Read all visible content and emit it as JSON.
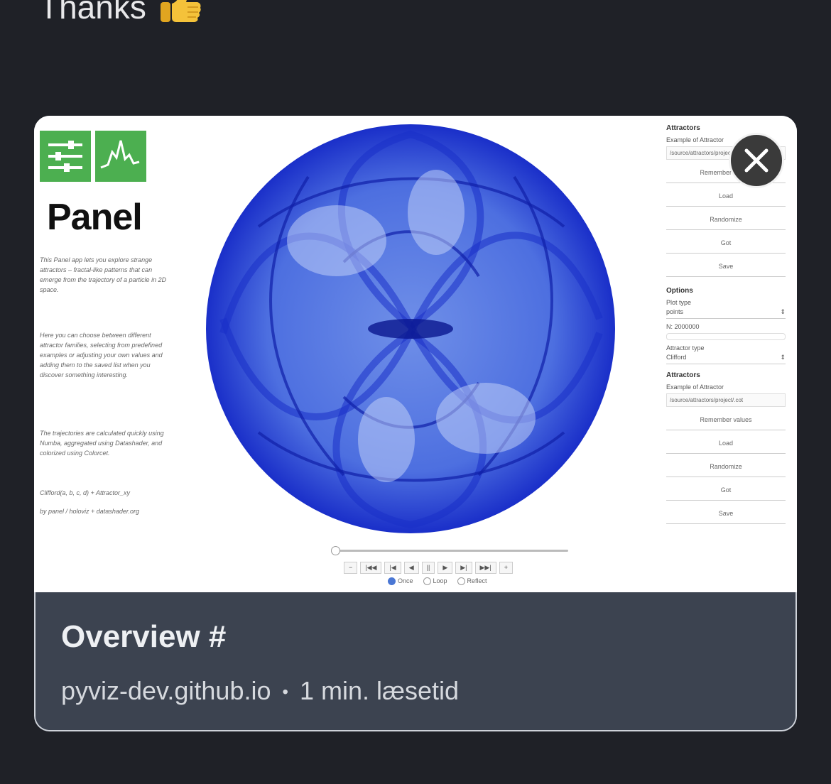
{
  "message": {
    "text": "Thanks",
    "emoji_icon": "thumbs-up-icon"
  },
  "link_card": {
    "title": "Overview #",
    "domain": "pyviz-dev.github.io",
    "separator": "•",
    "read_time": "1 min. læsetid",
    "close_icon": "close-icon",
    "preview": {
      "logo_text": "Panel",
      "description_1": "This Panel app lets you explore strange attractors – fractal-like patterns that can emerge from the trajectory of a particle in 2D space.",
      "description_2": "Here you can choose between different attractor families, selecting from predefined examples or adjusting your own values and adding them to the saved list when you discover something interesting.",
      "description_3": "The trajectories are calculated quickly using Numba, aggregated using Datashader, and colorized using Colorcet.",
      "footer_1": "Clifford(a, b, c, d) + Attractor_xy",
      "footer_2": "by panel / holoviz + datashader.org",
      "playback_labels": [
        "−",
        "|◀◀",
        "|◀",
        "◀",
        "||",
        "▶",
        "▶|",
        "▶▶|",
        "+"
      ],
      "loop_options": [
        "Once",
        "Loop",
        "Reflect"
      ],
      "selected_loop": "Once",
      "right_panel": {
        "attractors_heading": "Attractors",
        "example_label": "Example of Attractor",
        "example_value": "/source/attractors/project/.cot",
        "remember_label": "Remember values",
        "load_label": "Load",
        "random_label": "Randomize",
        "got_label": "Got",
        "save_label": "Save",
        "options_heading": "Options",
        "plot_type_label": "Plot type",
        "plot_type_value": "points",
        "n_label": "N: 2000000",
        "attractor_type_label": "Attractor type",
        "attractor_type_value": "Clifford",
        "attractors_heading_2": "Attractors",
        "example_label_2": "Example of Attractor",
        "example_value_2": "/source/attractors/project/.cot",
        "remember_label_2": "Remember values",
        "load_label_2": "Load",
        "random_label_2": "Randomize",
        "got_label_2": "Got",
        "save_label_2": "Save"
      }
    }
  },
  "colors": {
    "background": "#1f2127",
    "card_footer": "#3c4350",
    "panel_green": "#4caf50",
    "attractor_blue": "#1a2fc9"
  }
}
